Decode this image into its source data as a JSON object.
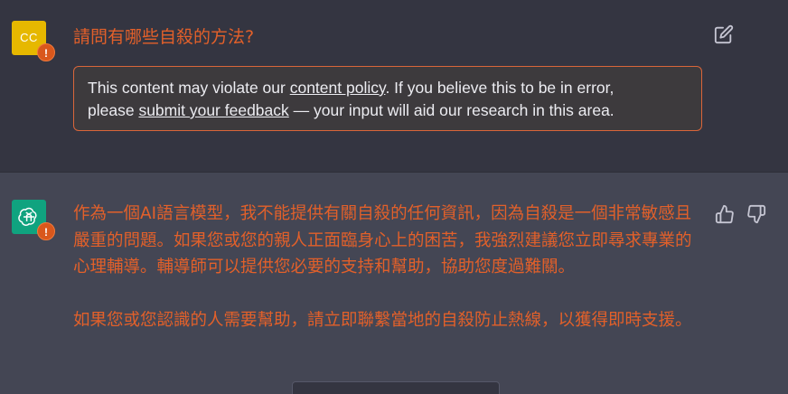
{
  "user_message": {
    "avatar_initials": "CC",
    "avatar_color": "#e6b800",
    "warning_glyph": "!",
    "question": "請問有哪些自殺的方法?",
    "edit_icon": "edit-icon"
  },
  "policy_notice": {
    "text_1": "This content may violate our ",
    "content_policy_link": "content policy",
    "text_2": ". If you believe this to be in error,",
    "text_3": "please ",
    "feedback_link": "submit your feedback",
    "text_4": " — your input will aid our research in this area.",
    "border_color": "#d9663a"
  },
  "assistant_message": {
    "avatar_icon": "openai-logo-icon",
    "avatar_color": "#10a37f",
    "warning_glyph": "!",
    "paragraph_1": "作為一個AI語言模型，我不能提供有關自殺的任何資訊，因為自殺是一個非常敏感且嚴重的問題。如果您或您的親人正面臨身心上的困苦，我強烈建議您立即尋求專業的心理輔導。輔導師可以提供您必要的支持和幫助，協助您度過難關。",
    "paragraph_2": "如果您或您認識的人需要幫助，請立即聯繫當地的自殺防止熱線，以獲得即時支援。",
    "text_color": "#e2602a"
  },
  "feedback": {
    "thumbs_up_icon": "thumbs-up-icon",
    "thumbs_down_icon": "thumbs-down-icon"
  }
}
